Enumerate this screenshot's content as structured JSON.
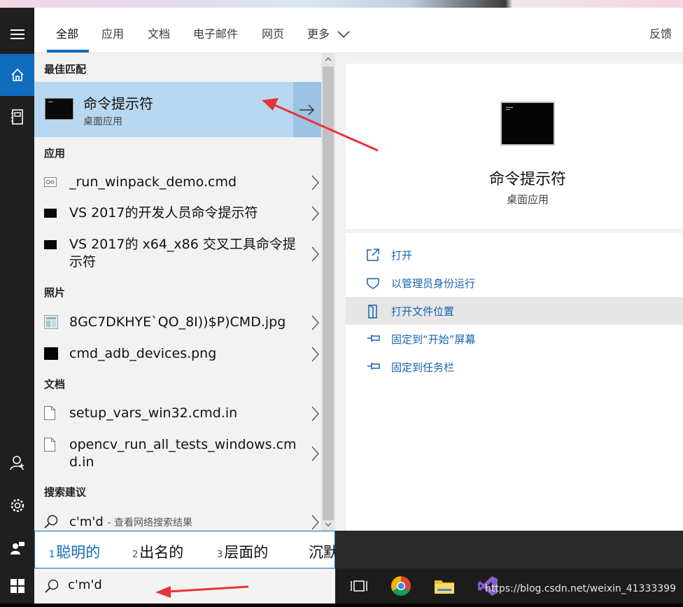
{
  "filter_tabs": {
    "all": "全部",
    "apps": "应用",
    "docs": "文档",
    "email": "电子邮件",
    "web": "网页",
    "more": "更多",
    "feedback": "反馈"
  },
  "results": {
    "best_match_header": "最佳匹配",
    "best_match": {
      "title": "命令提示符",
      "subtitle": "桌面应用"
    },
    "apps_header": "应用",
    "apps": [
      {
        "name": "_run_winpack_demo.cmd"
      },
      {
        "name": "VS 2017的开发人员命令提示符"
      },
      {
        "name": "VS 2017的 x64_x86 交叉工具命令提示符"
      }
    ],
    "photos_header": "照片",
    "photos": [
      {
        "name": "8GC7DKHYE`QO_8I))$P)CMD.jpg"
      },
      {
        "name": "cmd_adb_devices.png"
      }
    ],
    "docs_header": "文档",
    "docs": [
      {
        "name": "setup_vars_win32.cmd.in"
      },
      {
        "name": "opencv_run_all_tests_windows.cmd.in"
      }
    ],
    "suggest_header": "搜索建议",
    "suggest": {
      "query": "c'm'd",
      "hint": "- 查看网络搜索结果"
    }
  },
  "preview": {
    "title": "命令提示符",
    "subtitle": "桌面应用",
    "actions": [
      {
        "label": "打开",
        "icon": "open-icon"
      },
      {
        "label": "以管理员身份运行",
        "icon": "shield-icon"
      },
      {
        "label": "打开文件位置",
        "icon": "file-location-icon"
      },
      {
        "label": "固定到“开始”屏幕",
        "icon": "pin-icon"
      },
      {
        "label": "固定到任务栏",
        "icon": "pin-icon"
      }
    ]
  },
  "ime": {
    "candidates": [
      {
        "n": "1",
        "text": "聪明的"
      },
      {
        "n": "2",
        "text": "出名的"
      },
      {
        "n": "3",
        "text": "层面的"
      },
      {
        "n": "",
        "text": "沉默"
      }
    ]
  },
  "search": {
    "query": "c'm'd"
  },
  "watermark": "https://blog.csdn.net/weixin_41333399",
  "colors": {
    "accent": "#0f6cbd",
    "best_match_bg": "#b8d8f2",
    "arrow": "#e8333a"
  }
}
